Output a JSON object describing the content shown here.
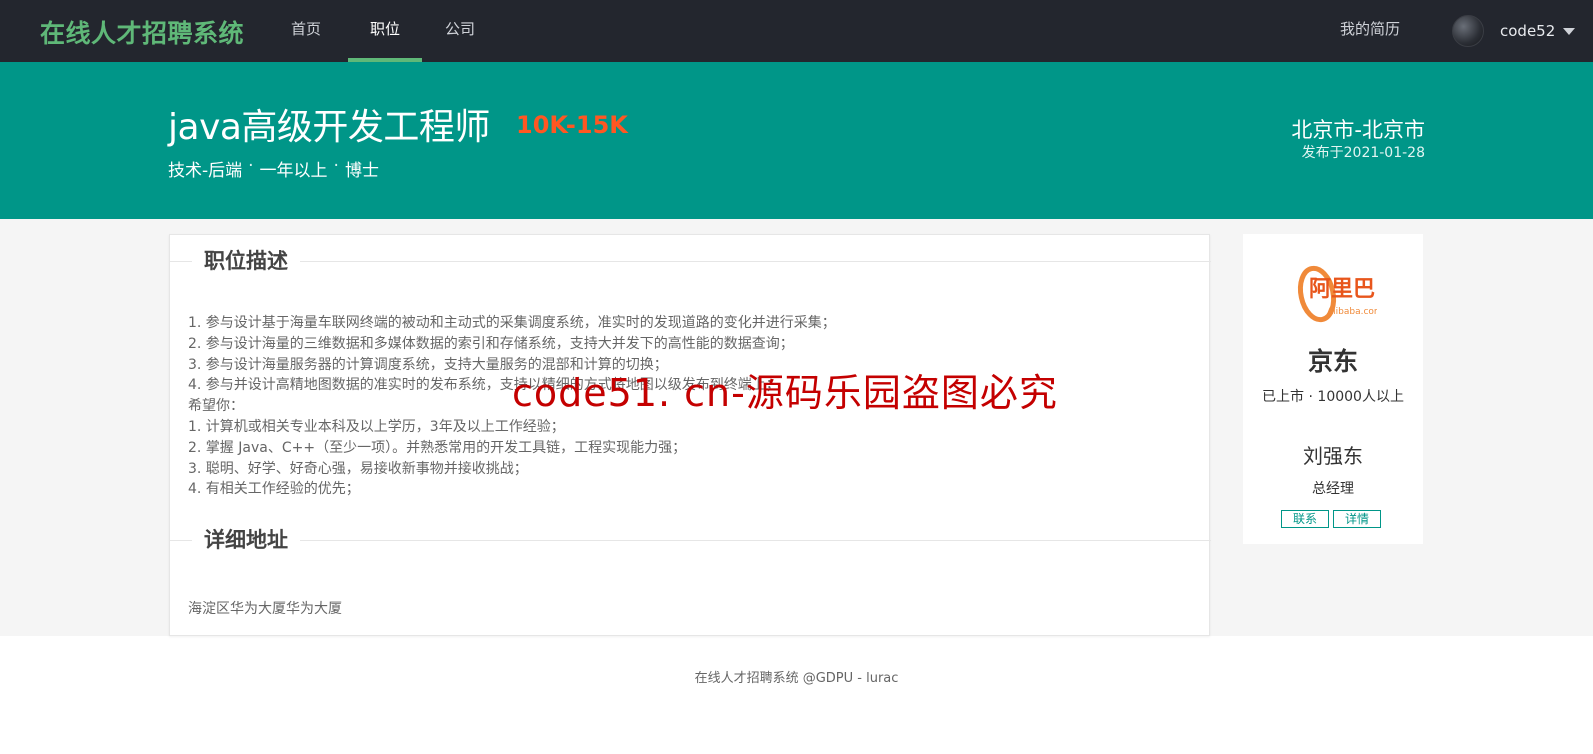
{
  "header": {
    "brand": "在线人才招聘系统",
    "nav": [
      {
        "label": "首页"
      },
      {
        "label": "职位"
      },
      {
        "label": "公司"
      }
    ],
    "active_nav": "职位",
    "resume_label": "我的简历",
    "username": "code52",
    "colors": {
      "bar": "#23262e",
      "brand": "#5fb878",
      "active_underline": "#5fb878"
    }
  },
  "job": {
    "title": "java高级开发工程师",
    "salary": "10K-15K",
    "category": "技术-后端",
    "experience": "一年以上",
    "education": "博士",
    "separator": "·",
    "city": "北京市-北京市",
    "published": "发布于2021-01-28",
    "banner_color": "#009688",
    "salary_color": "#ff5722"
  },
  "sections": {
    "description_title": "职位描述",
    "description_lines": [
      "1. 参与设计基于海量车联网终端的被动和主动式的采集调度系统，准实时的发现道路的变化并进行采集；",
      "2. 参与设计海量的三维数据和多媒体数据的索引和存储系统，支持大并发下的高性能的数据查询；",
      "3. 参与设计海量服务器的计算调度系统，支持大量服务的混部和计算的切换；",
      "4. 参与并设计高精地图数据的准实时的发布系统，支持以精细的方式将地图以级发布到终端上；",
      "希望你：",
      "1. 计算机或相关专业本科及以上学历，3年及以上工作经验；",
      "2. 掌握 Java、C++（至少一项）。并熟悉常用的开发工具链，工程实现能力强；",
      "3. 聪明、好学、好奇心强，易接收新事物并接收挑战；",
      "4. 有相关工作经验的优先；"
    ],
    "address_title": "详细地址",
    "address": "海淀区华为大厦华为大厦"
  },
  "company": {
    "logo_text": "阿里巴巴",
    "logo_sub": "Alibaba.com",
    "name": "京东",
    "status": "已上市",
    "size": "10000人以上",
    "contact_name": "刘强东",
    "contact_title": "总经理",
    "contact_button": "联系",
    "detail_button": "详情"
  },
  "watermark": "code51. cn-源码乐园盗图必究",
  "footer": "在线人才招聘系统 @GDPU - lurac"
}
